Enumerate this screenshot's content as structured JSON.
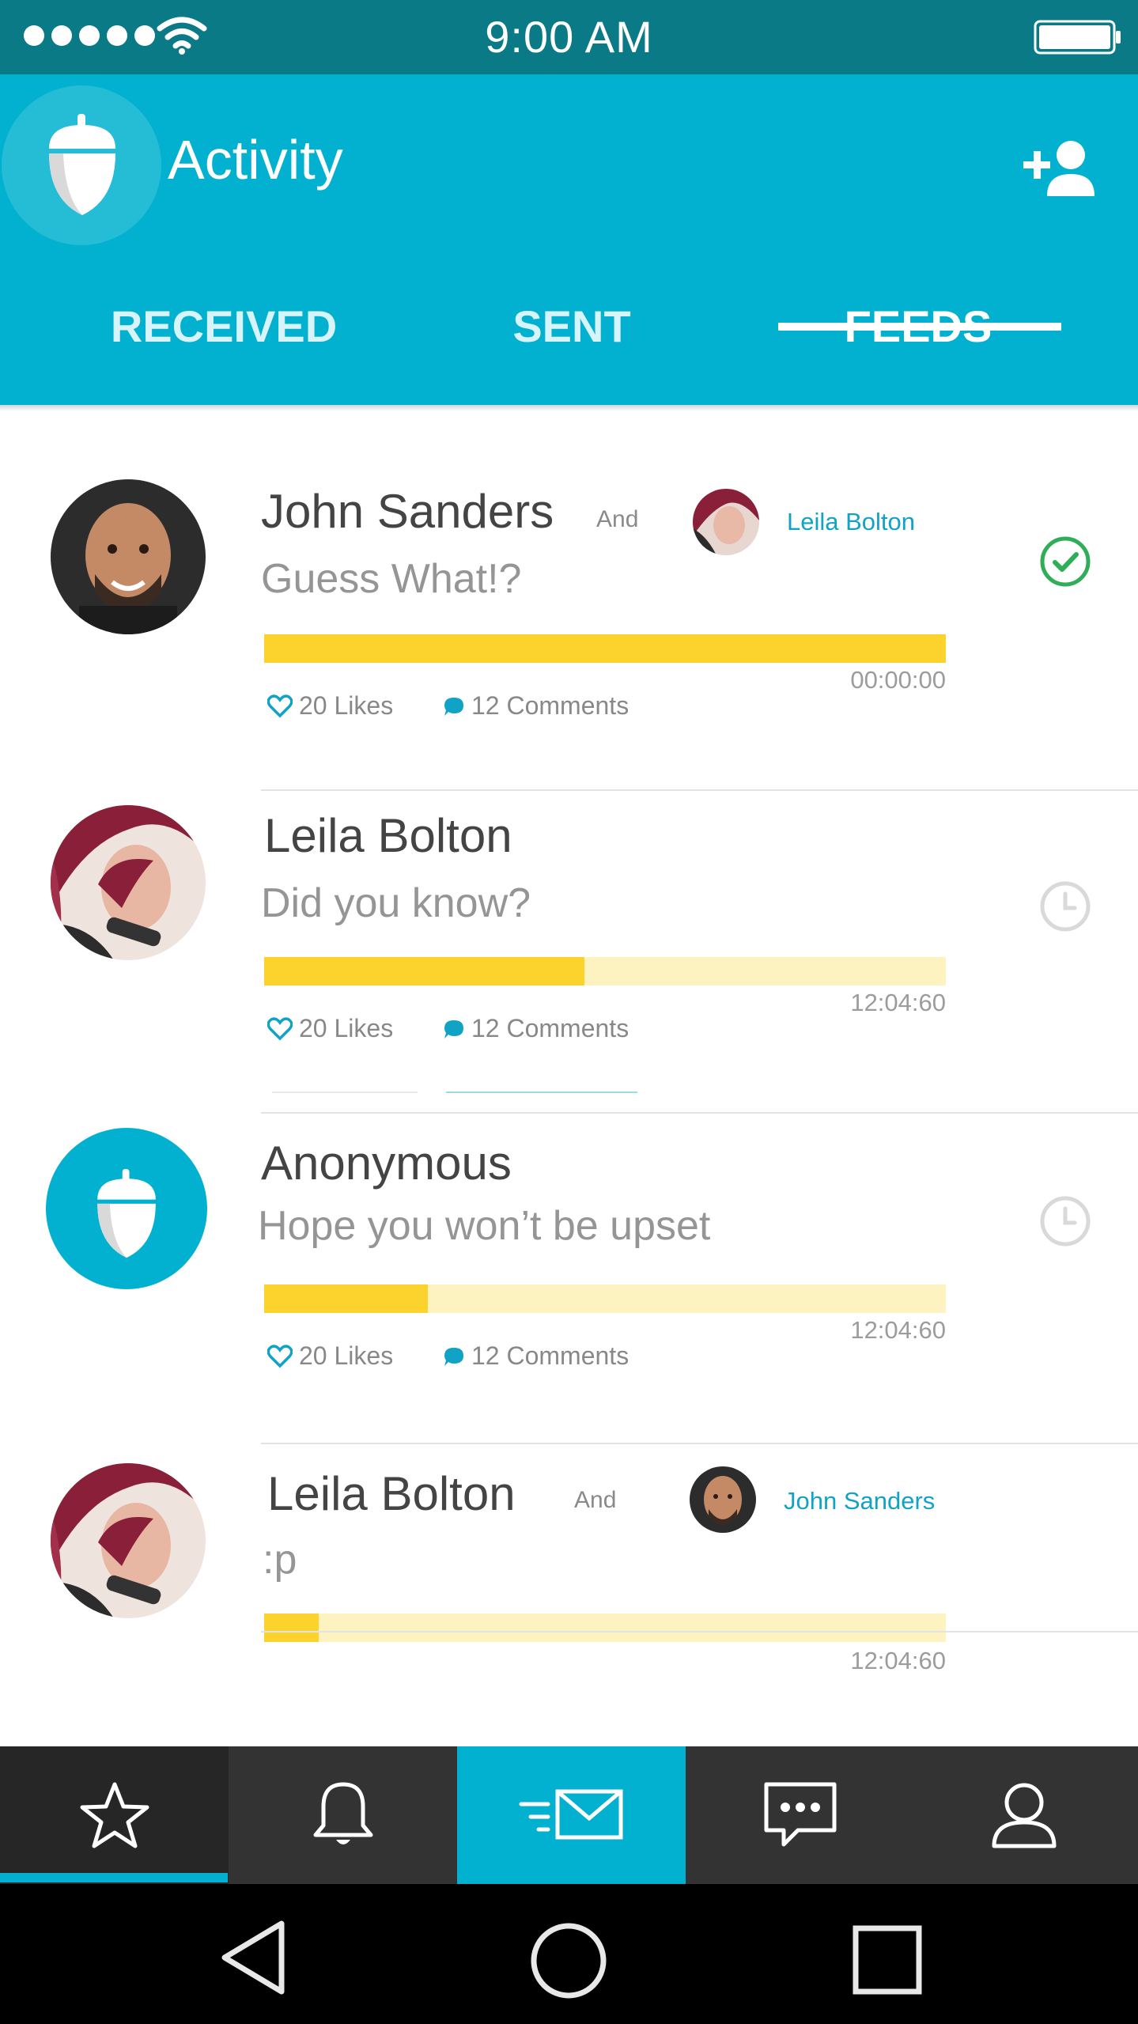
{
  "status_bar": {
    "time": "9:00 AM"
  },
  "header": {
    "title": "Activity"
  },
  "tabs": [
    {
      "label": "RECEIVED"
    },
    {
      "label": "SENT"
    },
    {
      "label": "FEEDS"
    }
  ],
  "active_tab": "FEEDS",
  "feed": [
    {
      "sender": "John Sanders",
      "connector": "And",
      "recipient": "Leila Bolton",
      "message": "Guess What!?",
      "progress": 1.0,
      "time": "00:00:00",
      "likes": "20 Likes",
      "comments": "12 Comments",
      "status_icon": "check-circle-icon"
    },
    {
      "sender": "Leila Bolton",
      "message": "Did you know?",
      "progress": 0.47,
      "time": "12:04:60",
      "likes": "20 Likes",
      "comments": "12 Comments",
      "status_icon": "clock-icon"
    },
    {
      "sender": "Anonymous",
      "message": "Hope you won’t be upset",
      "progress": 0.24,
      "time": "12:04:60",
      "likes": "20 Likes",
      "comments": "12 Comments",
      "status_icon": "clock-icon"
    },
    {
      "sender": "Leila Bolton",
      "connector": "And",
      "recipient": "John Sanders",
      "message": ":p",
      "progress": 0.08,
      "time": "12:04:60"
    }
  ],
  "bottom_nav": [
    {
      "icon": "star-icon",
      "selected": true
    },
    {
      "icon": "bell-icon"
    },
    {
      "icon": "send-mail-icon",
      "highlighted": true
    },
    {
      "icon": "chat-icon"
    },
    {
      "icon": "profile-icon"
    }
  ],
  "colors": {
    "status_bar": "#0a7b86",
    "primary": "#02b1cf",
    "progress_fill": "#fcd22c",
    "progress_track": "#fdf3c0",
    "check_green": "#2fae57",
    "link": "#11a3c6"
  }
}
